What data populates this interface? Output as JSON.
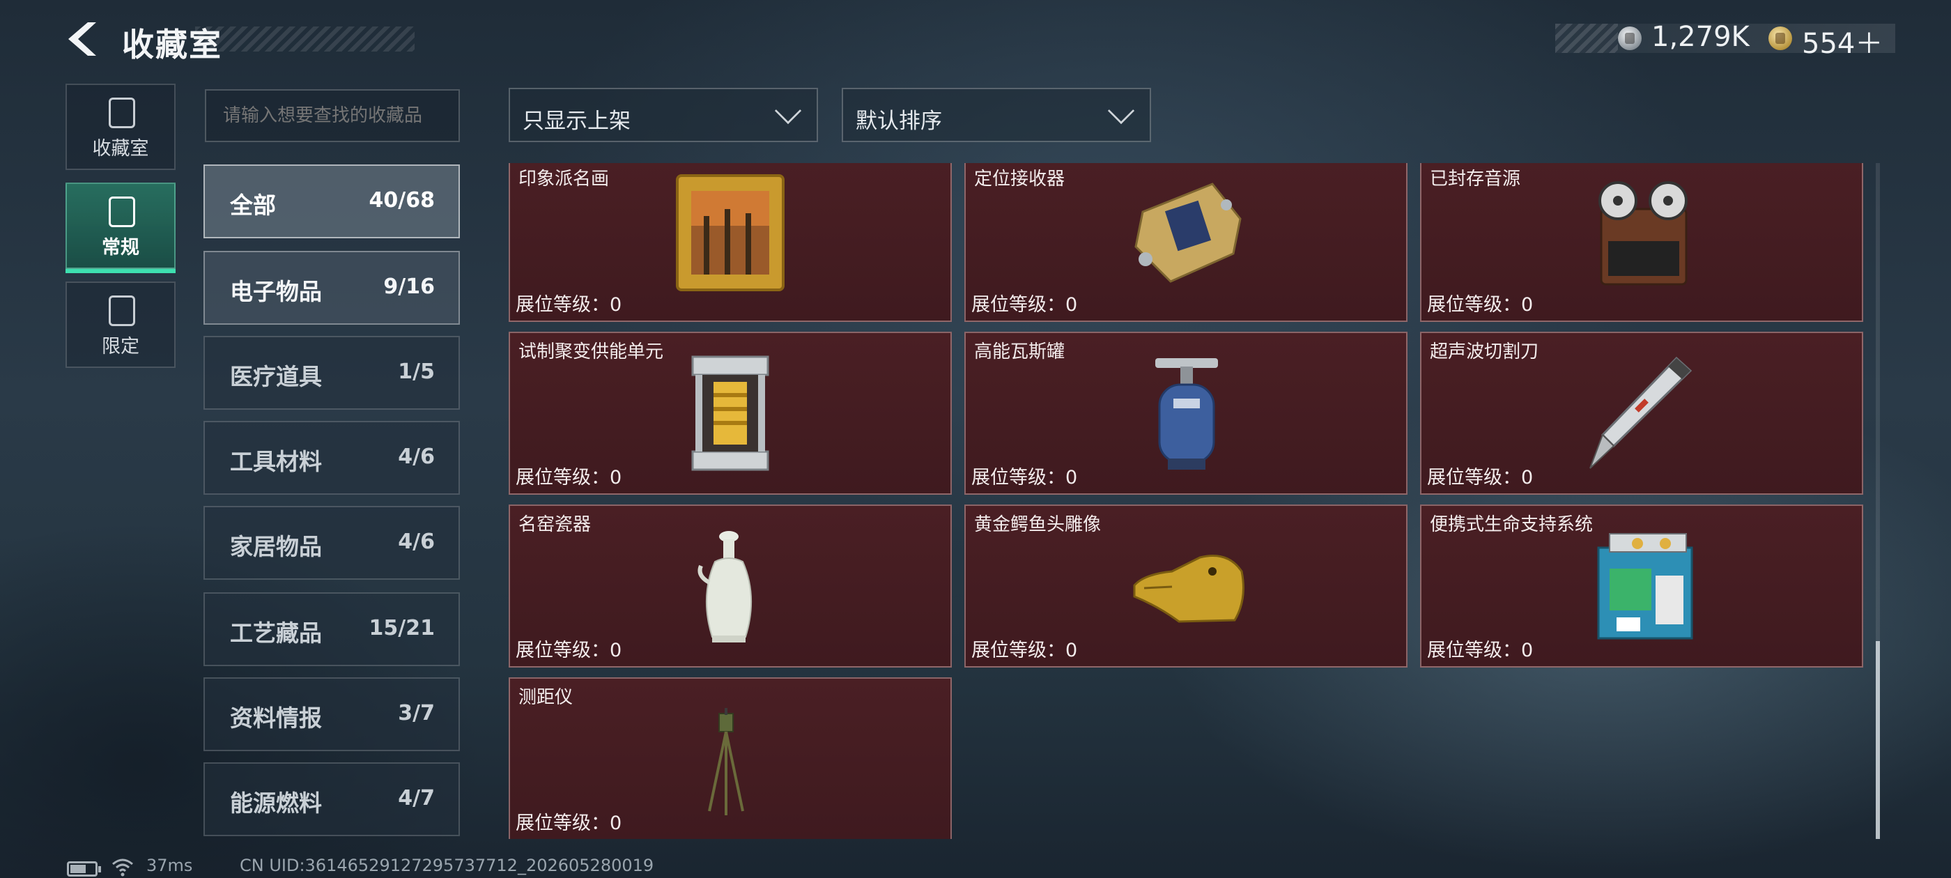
{
  "header": {
    "title": "收藏室",
    "currency": [
      {
        "icon": "silver-coin-icon",
        "value": "1,279K"
      },
      {
        "icon": "gold-coin-icon",
        "value": "554＋"
      }
    ]
  },
  "modes": [
    {
      "label": "收藏室",
      "icon": "collection-icon"
    },
    {
      "label": "常规",
      "icon": "regular-icon",
      "active": true
    },
    {
      "label": "限定",
      "icon": "limited-icon"
    }
  ],
  "search": {
    "placeholder": "请输入想要查找的收藏品"
  },
  "filters": {
    "shelf_filter": "只显示上架",
    "sort": "默认排序"
  },
  "categories": [
    {
      "name": "全部",
      "count": "40/68"
    },
    {
      "name": "电子物品",
      "count": "9/16"
    },
    {
      "name": "医疗道具",
      "count": "1/5"
    },
    {
      "name": "工具材料",
      "count": "4/6"
    },
    {
      "name": "家居物品",
      "count": "4/6"
    },
    {
      "name": "工艺藏品",
      "count": "15/21"
    },
    {
      "name": "资料情报",
      "count": "3/7"
    },
    {
      "name": "能源燃料",
      "count": "4/7"
    }
  ],
  "items": [
    {
      "name": "印象派名画",
      "level": "展位等级：0",
      "art": "painting"
    },
    {
      "name": "定位接收器",
      "level": "展位等级：0",
      "art": "receiver"
    },
    {
      "name": "已封存音源",
      "level": "展位等级：0",
      "art": "tape"
    },
    {
      "name": "试制聚变供能单元",
      "level": "展位等级：0",
      "art": "fusion"
    },
    {
      "name": "高能瓦斯罐",
      "level": "展位等级：0",
      "art": "gas"
    },
    {
      "name": "超声波切割刀",
      "level": "展位等级：0",
      "art": "knife"
    },
    {
      "name": "名窑瓷器",
      "level": "展位等级：0",
      "art": "vase"
    },
    {
      "name": "黄金鳄鱼头雕像",
      "level": "展位等级：0",
      "art": "croc"
    },
    {
      "name": "便携式生命支持系统",
      "level": "展位等级：0",
      "art": "lifesupport"
    },
    {
      "name": "测距仪",
      "level": "展位等级：0",
      "art": "rangefinder"
    }
  ],
  "footer": {
    "ping": "37ms",
    "uid": "CN UID:36146529127295737712_202605280019"
  }
}
